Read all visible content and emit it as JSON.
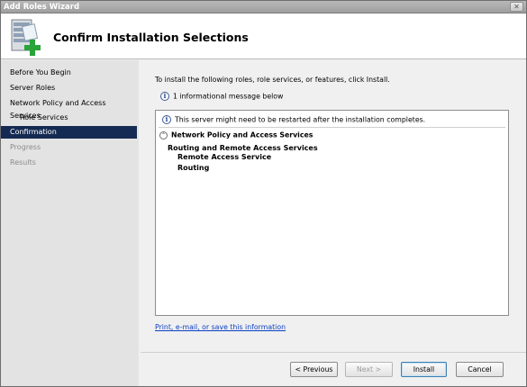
{
  "window": {
    "title": "Add Roles Wizard"
  },
  "header": {
    "title": "Confirm Installation Selections"
  },
  "nav": {
    "items": [
      {
        "label": "Before You Begin"
      },
      {
        "label": "Server Roles"
      },
      {
        "label": "Network Policy and Access Services"
      },
      {
        "label": "Role Services"
      },
      {
        "label": "Confirmation"
      },
      {
        "label": "Progress"
      },
      {
        "label": "Results"
      }
    ]
  },
  "main": {
    "intro": "To install the following roles, role services, or features, click Install.",
    "info_message": "1 informational message below",
    "panel": {
      "notice": "This server might need to be restarted after the installation completes.",
      "section_title": "Network Policy and Access Services",
      "role": "Routing and Remote Access Services",
      "services": [
        "Remote Access Service",
        "Routing"
      ]
    },
    "link": "Print, e-mail, or save this information"
  },
  "buttons": {
    "previous": "< Previous",
    "next": "Next >",
    "install": "Install",
    "cancel": "Cancel"
  },
  "icons": {
    "close": "close-icon",
    "logo": "server-add-icon",
    "info": "info-icon",
    "collapse": "collapse-icon"
  }
}
